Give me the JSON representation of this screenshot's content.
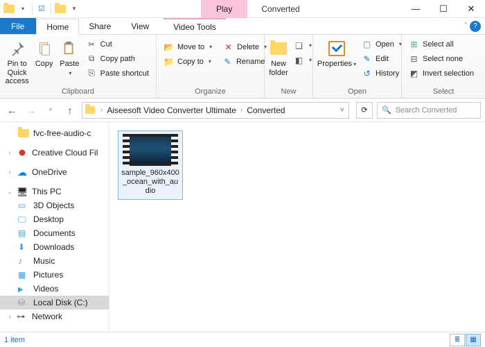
{
  "window": {
    "title": "Converted",
    "play_tab": "Play",
    "context_tab": "Video Tools"
  },
  "tabs": {
    "file": "File",
    "home": "Home",
    "share": "Share",
    "view": "View"
  },
  "ribbon": {
    "clipboard": {
      "label": "Clipboard",
      "pin": "Pin to Quick\naccess",
      "copy": "Copy",
      "paste": "Paste",
      "cut": "Cut",
      "copy_path": "Copy path",
      "paste_shortcut": "Paste shortcut"
    },
    "organize": {
      "label": "Organize",
      "move_to": "Move to",
      "copy_to": "Copy to",
      "delete": "Delete",
      "rename": "Rename"
    },
    "new": {
      "label": "New",
      "new_folder": "New\nfolder"
    },
    "open": {
      "label": "Open",
      "properties": "Properties",
      "open": "Open",
      "edit": "Edit",
      "history": "History"
    },
    "select": {
      "label": "Select",
      "select_all": "Select all",
      "select_none": "Select none",
      "invert": "Invert selection"
    }
  },
  "addressbar": {
    "crumb1": "Aiseesoft Video Converter Ultimate",
    "crumb2": "Converted",
    "search_placeholder": "Search Converted"
  },
  "tree": {
    "n0": "fvc-free-audio-c",
    "n1": "Creative Cloud Fil",
    "n2": "OneDrive",
    "n3": "This PC",
    "n4": "3D Objects",
    "n5": "Desktop",
    "n6": "Documents",
    "n7": "Downloads",
    "n8": "Music",
    "n9": "Pictures",
    "n10": "Videos",
    "n11": "Local Disk (C:)",
    "n12": "Network"
  },
  "file": {
    "name": "sample_960x400_ocean_with_audio"
  },
  "status": {
    "count": "1 item"
  }
}
